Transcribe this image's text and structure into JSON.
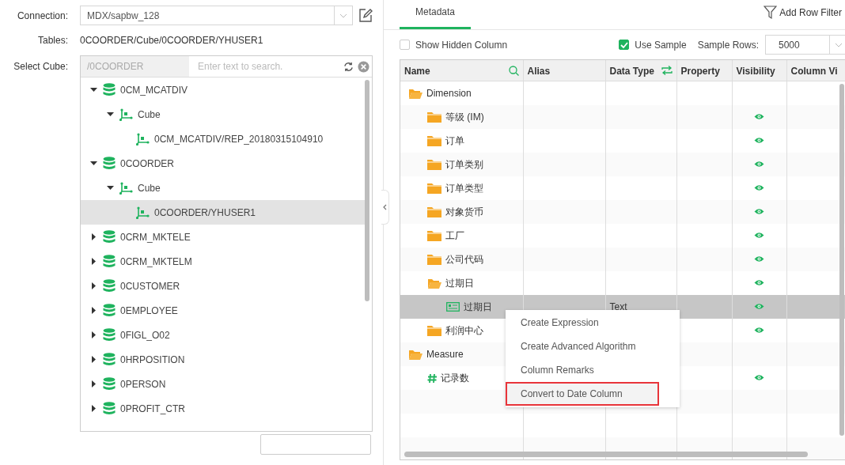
{
  "connection": {
    "label": "Connection:",
    "value": "MDX/sapbw_128"
  },
  "tables": {
    "label": "Tables:",
    "value": "0COORDER/Cube/0COORDER/YHUSER1"
  },
  "select_cube": {
    "label": "Select Cube:",
    "path": "/0COORDER",
    "placeholder": "Enter text to search."
  },
  "cube_tree": [
    {
      "kind": "database",
      "label": "0CM_MCATDIV",
      "expanded": true,
      "selected": false,
      "children": [
        {
          "kind": "cube",
          "label": "Cube",
          "expanded": true,
          "selected": false,
          "children": [
            {
              "kind": "cube",
              "label": "0CM_MCATDIV/REP_20180315104910",
              "selected": false
            }
          ]
        }
      ]
    },
    {
      "kind": "database",
      "label": "0COORDER",
      "expanded": true,
      "selected": false,
      "children": [
        {
          "kind": "cube",
          "label": "Cube",
          "expanded": true,
          "selected": false,
          "children": [
            {
              "kind": "cube",
              "label": "0COORDER/YHUSER1",
              "selected": true
            }
          ]
        }
      ]
    },
    {
      "kind": "database",
      "label": "0CRM_MKTELE",
      "expanded": false,
      "selected": false
    },
    {
      "kind": "database",
      "label": "0CRM_MKTELM",
      "expanded": false,
      "selected": false
    },
    {
      "kind": "database",
      "label": "0CUSTOMER",
      "expanded": false,
      "selected": false
    },
    {
      "kind": "database",
      "label": "0EMPLOYEE",
      "expanded": false,
      "selected": false
    },
    {
      "kind": "database",
      "label": "0FIGL_O02",
      "expanded": false,
      "selected": false
    },
    {
      "kind": "database",
      "label": "0HRPOSITION",
      "expanded": false,
      "selected": false
    },
    {
      "kind": "database",
      "label": "0PERSON",
      "expanded": false,
      "selected": false
    },
    {
      "kind": "database",
      "label": "0PROFIT_CTR",
      "expanded": false,
      "selected": false
    }
  ],
  "tabs": [
    {
      "label": "Metadata",
      "selected": true
    }
  ],
  "add_row_filter": "Add Row Filter",
  "show_hidden_column": {
    "label": "Show Hidden Column",
    "checked": false
  },
  "use_sample": {
    "label": "Use Sample",
    "checked": true
  },
  "sample_rows": {
    "label": "Sample Rows:",
    "value": "5000"
  },
  "table": {
    "columns": [
      "Name",
      "Alias",
      "Data Type",
      "Property",
      "Visibility",
      "Column Vi"
    ],
    "rows": [
      {
        "kind": "group",
        "name": "Dimension",
        "selected": false,
        "children": [
          {
            "kind": "dimension",
            "name": "等级 (IM)",
            "visible": true,
            "selected": false
          },
          {
            "kind": "dimension",
            "name": "订单",
            "visible": true,
            "selected": false
          },
          {
            "kind": "dimension",
            "name": "订单类别",
            "visible": true,
            "selected": false
          },
          {
            "kind": "dimension",
            "name": "订单类型",
            "visible": true,
            "selected": false
          },
          {
            "kind": "dimension",
            "name": "对象货币",
            "visible": true,
            "selected": false
          },
          {
            "kind": "dimension",
            "name": "工厂",
            "visible": true,
            "selected": false
          },
          {
            "kind": "dimension",
            "name": "公司代码",
            "visible": true,
            "selected": false
          },
          {
            "kind": "dimension",
            "name": "过期日",
            "visible": true,
            "selected": false,
            "expanded": true,
            "children": [
              {
                "kind": "field",
                "name": "过期日",
                "data_type": "Text",
                "visible": true,
                "selected": true
              }
            ]
          },
          {
            "kind": "dimension",
            "name": "利润中心",
            "visible": true,
            "selected": false
          }
        ]
      },
      {
        "kind": "group",
        "name": "Measure",
        "selected": false,
        "children": [
          {
            "kind": "measure",
            "name": "记录数",
            "visible": true,
            "selected": false
          }
        ]
      }
    ]
  },
  "context_menu": [
    {
      "label": "Create Expression",
      "highlighted": false
    },
    {
      "label": "Create Advanced Algorithm",
      "highlighted": false
    },
    {
      "label": "Column Remarks",
      "highlighted": false
    },
    {
      "label": "Convert to Date Column",
      "highlighted": true
    }
  ]
}
